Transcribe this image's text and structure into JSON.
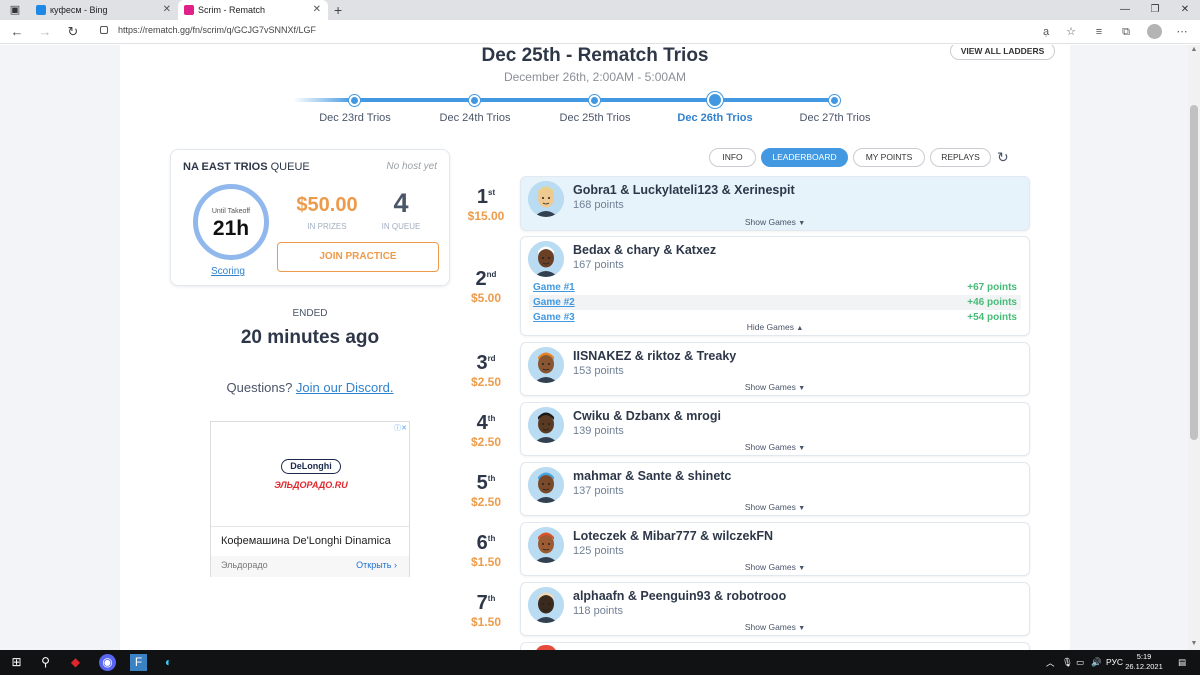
{
  "browser": {
    "tabs": [
      {
        "title": "куфесм - Bing"
      },
      {
        "title": "Scrim - Rematch"
      }
    ],
    "url": "https://rematch.gg/fn/scrim/q/GCJG7vSNNXf/LGF"
  },
  "header": {
    "title": "Dec 25th - Rematch Trios",
    "subtitle": "December 26th, 2:00AM - 5:00AM",
    "view_all": "VIEW ALL LADDERS"
  },
  "timeline": [
    {
      "label": "Dec 23rd Trios",
      "active": false
    },
    {
      "label": "Dec 24th Trios",
      "active": false
    },
    {
      "label": "Dec 25th Trios",
      "active": false
    },
    {
      "label": "Dec 26th Trios",
      "active": true
    },
    {
      "label": "Dec 27th Trios",
      "active": false
    }
  ],
  "queue_card": {
    "title_bold": "NA EAST TRIOS",
    "title_rest": "QUEUE",
    "host": "No host yet",
    "until_label": "Until Takeoff",
    "until_value": "21h",
    "scoring": "Scoring",
    "prize": "$50.00",
    "prize_label": "IN PRIZES",
    "queue_count": "4",
    "queue_label": "IN QUEUE",
    "join": "JOIN PRACTICE"
  },
  "status": {
    "ended": "ENDED",
    "ago": "20 minutes ago",
    "questions": "Questions?",
    "discord": "Join our Discord."
  },
  "ad": {
    "brand1": "DeLonghi",
    "brand2": "ЭЛЬДОРАДО.RU",
    "text": "Кофемашина De'Longhi Dinamica",
    "store": "Эльдорадо",
    "open": "Открыть"
  },
  "tabs": {
    "info": "INFO",
    "leaderboard": "LEADERBOARD",
    "my_points": "MY POINTS",
    "replays": "REPLAYS"
  },
  "leaderboard": [
    {
      "rank": "1",
      "suffix": "st",
      "prize": "$15.00",
      "team": "Gobra1 & Luckylateli123 & Xerinespit",
      "points": "168 points",
      "toggle": "Show Games",
      "skin": "#f0c990",
      "hair": "#e8d18a"
    },
    {
      "rank": "2",
      "suffix": "nd",
      "prize": "$5.00",
      "team": "Bedax & chary & Katxez",
      "points": "167 points",
      "toggle": "Hide Games",
      "skin": "#6b3f25",
      "hair": "#ffffff",
      "games": [
        {
          "name": "Game #1",
          "points": "+67 points"
        },
        {
          "name": "Game #2",
          "points": "+46 points"
        },
        {
          "name": "Game #3",
          "points": "+54 points"
        }
      ]
    },
    {
      "rank": "3",
      "suffix": "rd",
      "prize": "$2.50",
      "team": "IISNAKEZ & riktoz & Treaky",
      "points": "153 points",
      "toggle": "Show Games",
      "skin": "#8a5632",
      "hair": "#e2862e"
    },
    {
      "rank": "4",
      "suffix": "th",
      "prize": "$2.50",
      "team": "Cwiku & Dzbanx & mrogi",
      "points": "139 points",
      "toggle": "Show Games",
      "skin": "#5a3a22",
      "hair": "#1a1a1a"
    },
    {
      "rank": "5",
      "suffix": "th",
      "prize": "$2.50",
      "team": "mahmar & Sante & shinetc",
      "points": "137 points",
      "toggle": "Show Games",
      "skin": "#7a4a2a",
      "hair": "#4aa3df"
    },
    {
      "rank": "6",
      "suffix": "th",
      "prize": "$1.50",
      "team": "Loteczek & Mibar777 & wilczekFN",
      "points": "125 points",
      "toggle": "Show Games",
      "skin": "#9c5b33",
      "hair": "#d9542b"
    },
    {
      "rank": "7",
      "suffix": "th",
      "prize": "$1.50",
      "team": "alphaafn & Peenguin93 & robotrooo",
      "points": "118 points",
      "toggle": "Show Games",
      "skin": "#3a2a1e",
      "hair": "#f0d9b5"
    }
  ],
  "taskbar": {
    "lang": "РУС",
    "time": "5:19",
    "date": "26.12.2021"
  },
  "colors": {
    "accent": "#4299e1",
    "prize": "#ed9b4a",
    "points_green": "#48bb78"
  }
}
